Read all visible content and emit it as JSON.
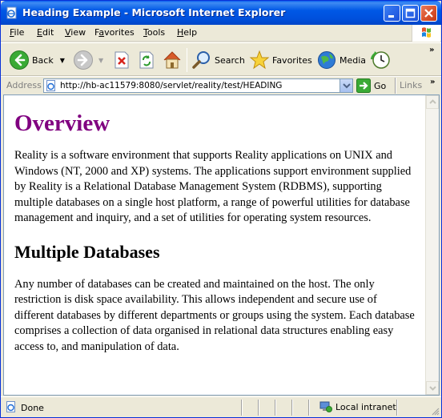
{
  "window": {
    "title": "Heading Example - Microsoft Internet Explorer"
  },
  "menu": {
    "items": [
      {
        "label": "File",
        "accel": "F",
        "rest": "ile"
      },
      {
        "label": "Edit",
        "accel": "E",
        "rest": "dit"
      },
      {
        "label": "View",
        "accel": "V",
        "rest": "iew"
      },
      {
        "label": "Favorites",
        "accel": "a",
        "pre": "F",
        "rest": "vorites"
      },
      {
        "label": "Tools",
        "accel": "T",
        "rest": "ools"
      },
      {
        "label": "Help",
        "accel": "H",
        "rest": "elp"
      }
    ]
  },
  "toolbar": {
    "back_label": "Back",
    "search_label": "Search",
    "favorites_label": "Favorites",
    "media_label": "Media",
    "overflow": "»"
  },
  "address": {
    "label": "Address",
    "url": "http://hb-ac11579:8080/servlet/reality/test/HEADING",
    "go_label": "Go",
    "links_label": "Links",
    "overflow": "»"
  },
  "page": {
    "heading1": "Overview",
    "para1": "Reality is a software environment that supports Reality applications on UNIX and Windows (NT, 2000 and XP) systems. The applications support environment supplied by Reality is a Relational Database Management System (RDBMS), supporting multiple databases on a single host platform, a range of powerful utilities for database management and inquiry, and a set of utilities for operating system resources.",
    "heading2": "Multiple Databases",
    "para2": "Any number of databases can be created and maintained on the host. The only restriction is disk space availability. This allows independent and secure use of different databases by different departments or groups using the system. Each database comprises a collection of data organised in relational data structures enabling easy access to, and manipulation of data."
  },
  "status": {
    "text": "Done",
    "zone": "Local intranet"
  },
  "colors": {
    "heading1": "#800080",
    "titlebar": "#0058E6",
    "chrome": "#ECE9D8"
  }
}
